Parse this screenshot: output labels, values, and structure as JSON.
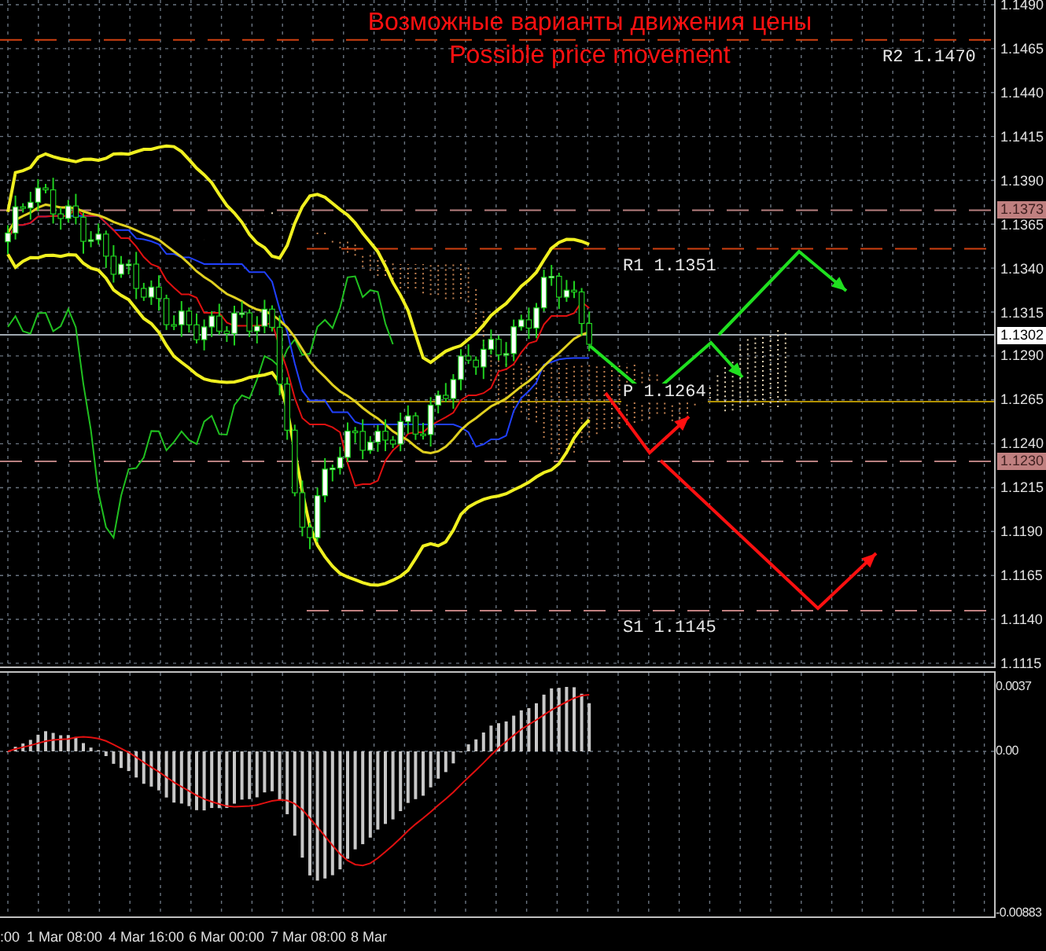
{
  "title_ru": "Возможные варианты движения цены",
  "title_en": "Possible price movement",
  "pivot_levels": [
    {
      "label": "R2 1.1470"
    },
    {
      "label": "R1 1.1351"
    },
    {
      "label": "P 1.1264"
    },
    {
      "label": "S1 1.1145"
    }
  ],
  "price_axis": {
    "ticks": [
      "1.1490",
      "1.1465",
      "1.1440",
      "1.1415",
      "1.1390",
      "1.1365",
      "1.1340",
      "1.1315",
      "1.1290",
      "1.1265",
      "1.1240",
      "1.1215",
      "1.1190",
      "1.1165",
      "1.1140",
      "1.1115"
    ]
  },
  "price_badges": [
    {
      "text": "1.1373",
      "kind": "level"
    },
    {
      "text": "1.1302",
      "kind": "current"
    },
    {
      "text": "1.1230",
      "kind": "level"
    }
  ],
  "macd_axis": {
    "ticks": [
      "0.0037",
      "0.00",
      "-0.00883"
    ]
  },
  "time_axis": {
    "labels": [
      ":00",
      "1 Mar 08:00",
      "4 Mar 16:00",
      "6 Mar 00:00",
      "7 Mar 08:00",
      "8 Mar"
    ]
  }
}
